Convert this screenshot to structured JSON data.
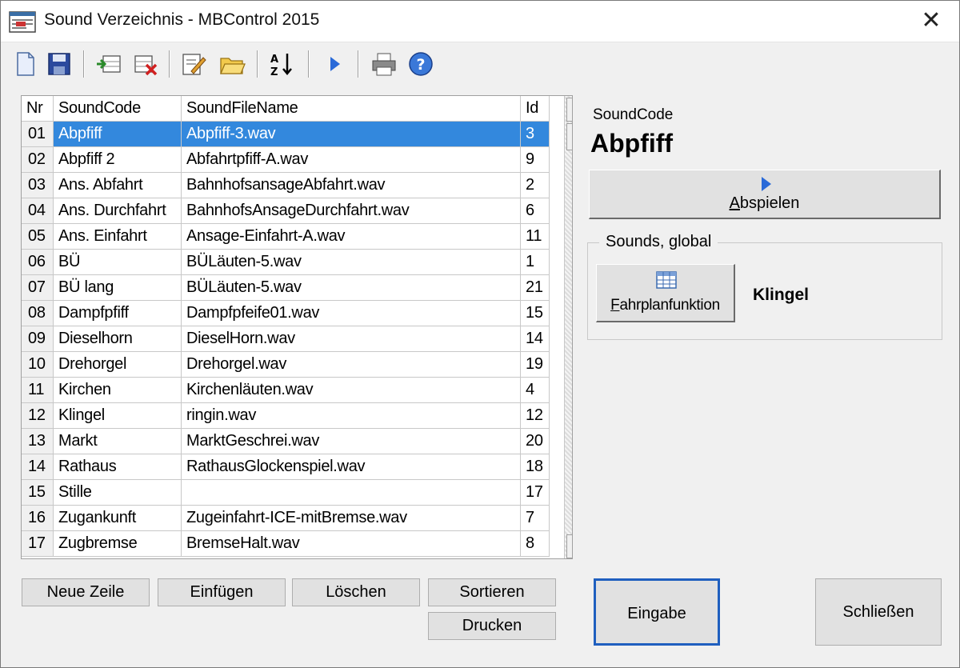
{
  "window": {
    "title": "Sound Verzeichnis - MBControl 2015",
    "close_glyph": "✕"
  },
  "toolbar": {
    "buttons": [
      {
        "name": "new-document-icon"
      },
      {
        "name": "save-icon"
      },
      {
        "name": "insert-row-icon"
      },
      {
        "name": "delete-row-icon"
      },
      {
        "name": "edit-icon"
      },
      {
        "name": "open-folder-icon"
      },
      {
        "name": "sort-az-icon"
      },
      {
        "name": "play-icon"
      },
      {
        "name": "print-icon"
      },
      {
        "name": "help-icon"
      }
    ]
  },
  "grid": {
    "columns": [
      "Nr",
      "SoundCode",
      "SoundFileName",
      "Id"
    ],
    "selected_index": 0,
    "rows": [
      {
        "nr": "01",
        "code": "Abpfiff",
        "file": "Abpfiff-3.wav",
        "id": "3"
      },
      {
        "nr": "02",
        "code": "Abpfiff 2",
        "file": "Abfahrtpfiff-A.wav",
        "id": "9"
      },
      {
        "nr": "03",
        "code": "Ans. Abfahrt",
        "file": "BahnhofsansageAbfahrt.wav",
        "id": "2"
      },
      {
        "nr": "04",
        "code": "Ans. Durchfahrt",
        "file": "BahnhofsAnsageDurchfahrt.wav",
        "id": "6"
      },
      {
        "nr": "05",
        "code": "Ans. Einfahrt",
        "file": "Ansage-Einfahrt-A.wav",
        "id": "11"
      },
      {
        "nr": "06",
        "code": "BÜ",
        "file": "BÜLäuten-5.wav",
        "id": "1"
      },
      {
        "nr": "07",
        "code": "BÜ lang",
        "file": "BÜLäuten-5.wav",
        "id": "21"
      },
      {
        "nr": "08",
        "code": "Dampfpfiff",
        "file": "Dampfpfeife01.wav",
        "id": "15"
      },
      {
        "nr": "09",
        "code": "Dieselhorn",
        "file": "DieselHorn.wav",
        "id": "14"
      },
      {
        "nr": "10",
        "code": "Drehorgel",
        "file": "Drehorgel.wav",
        "id": "19"
      },
      {
        "nr": "11",
        "code": "Kirchen",
        "file": "Kirchenläuten.wav",
        "id": "4"
      },
      {
        "nr": "12",
        "code": "Klingel",
        "file": "ringin.wav",
        "id": "12"
      },
      {
        "nr": "13",
        "code": "Markt",
        "file": "MarktGeschrei.wav",
        "id": "20"
      },
      {
        "nr": "14",
        "code": "Rathaus",
        "file": "RathausGlockenspiel.wav",
        "id": "18"
      },
      {
        "nr": "15",
        "code": "Stille",
        "file": "",
        "id": "17"
      },
      {
        "nr": "16",
        "code": "Zugankunft",
        "file": "Zugeinfahrt-ICE-mitBremse.wav",
        "id": "7"
      },
      {
        "nr": "17",
        "code": "Zugbremse",
        "file": "BremseHalt.wav",
        "id": "8"
      }
    ]
  },
  "grid_buttons": {
    "new_row": "Neue Zeile",
    "insert": "Einfügen",
    "delete": "Löschen",
    "sort": "Sortieren",
    "print": "Drucken"
  },
  "detail": {
    "soundcode_label": "SoundCode",
    "soundcode_value": "Abpfiff",
    "play_button": {
      "label_first": "A",
      "label_rest": "bspielen"
    },
    "group_title": "Sounds, global",
    "timetable_button": {
      "label_first": "F",
      "label_rest": "ahrplanfunktion"
    },
    "global_sound_value": "Klingel"
  },
  "footer": {
    "enter_label": "Eingabe",
    "close_label": "Schließen"
  },
  "colors": {
    "selection": "#3388dd",
    "accent_border": "#1f5fbf"
  }
}
